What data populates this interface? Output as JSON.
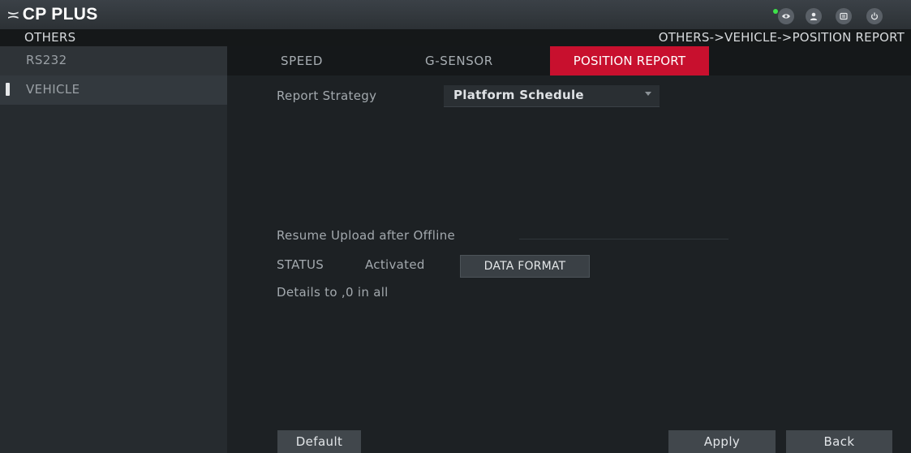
{
  "app": {
    "brand": "CP PLUS",
    "logo_mark": "≍"
  },
  "titlebar": {
    "icons": [
      "live-view-icon",
      "user-icon",
      "system-info-icon",
      "power-icon"
    ],
    "status_dot_color": "#3ee24a"
  },
  "section": {
    "label": "OTHERS",
    "breadcrumb": "OTHERS->VEHICLE->POSITION REPORT"
  },
  "sidebar": {
    "items": [
      {
        "label": "RS232"
      },
      {
        "label": "VEHICLE",
        "active": true
      }
    ]
  },
  "tabs": [
    {
      "label": "SPEED"
    },
    {
      "label": "G-SENSOR"
    },
    {
      "label": "POSITION REPORT",
      "active": true
    }
  ],
  "form": {
    "report_strategy_label": "Report Strategy",
    "report_strategy_value": "Platform Schedule",
    "resume_upload_label": "Resume Upload after Offline",
    "status_label": "STATUS",
    "status_value": "Activated",
    "data_format_label": "DATA FORMAT",
    "details_label": "Details to ,0 in all"
  },
  "buttons": {
    "default": "Default",
    "apply": "Apply",
    "back": "Back"
  },
  "colors": {
    "accent": "#c8102e",
    "background": "#1d2124"
  }
}
